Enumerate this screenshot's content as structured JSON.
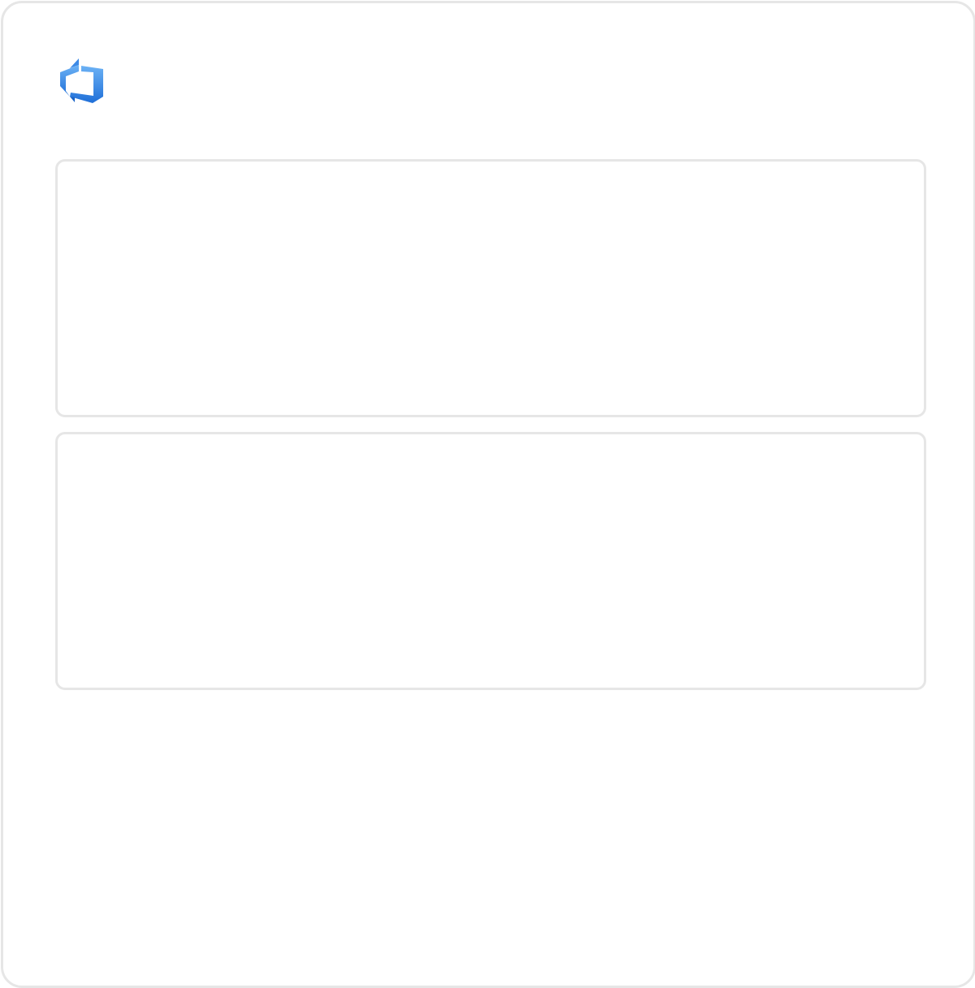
{
  "logo": {
    "icon": "azure-devops-icon",
    "colors": {
      "primary": "#2e7de0",
      "light": "#5aa9f2"
    }
  },
  "panels": [
    {
      "id": "top-panel"
    },
    {
      "id": "bottom-panel"
    }
  ]
}
